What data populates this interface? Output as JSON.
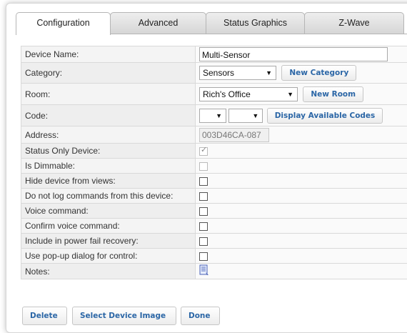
{
  "tabs": [
    {
      "label": "Configuration",
      "active": true
    },
    {
      "label": "Advanced",
      "active": false
    },
    {
      "label": "Status Graphics",
      "active": false
    },
    {
      "label": "Z-Wave",
      "active": false
    }
  ],
  "form": {
    "device_name": {
      "label": "Device Name:",
      "value": "Multi-Sensor"
    },
    "category": {
      "label": "Category:",
      "value": "Sensors",
      "button": "New Category"
    },
    "room": {
      "label": "Room:",
      "value": "Rich's Office",
      "button": "New Room"
    },
    "code": {
      "label": "Code:",
      "value1": "",
      "value2": "",
      "button": "Display Available Codes"
    },
    "address": {
      "label": "Address:",
      "value": "003D46CA-087"
    },
    "checkboxes": [
      {
        "label": "Status Only Device:",
        "checked": true,
        "disabled": true
      },
      {
        "label": "Is Dimmable:",
        "checked": false,
        "disabled": true
      },
      {
        "label": "Hide device from views:",
        "checked": false,
        "disabled": false
      },
      {
        "label": "Do not log commands from this device:",
        "checked": false,
        "disabled": false
      },
      {
        "label": "Voice command:",
        "checked": false,
        "disabled": false
      },
      {
        "label": "Confirm voice command:",
        "checked": false,
        "disabled": false
      },
      {
        "label": "Include in power fail recovery:",
        "checked": false,
        "disabled": false
      },
      {
        "label": "Use pop-up dialog for control:",
        "checked": false,
        "disabled": false
      }
    ],
    "notes": {
      "label": "Notes:",
      "icon": "notes-icon"
    }
  },
  "actions": {
    "delete": "Delete",
    "select_image": "Select Device Image",
    "done": "Done"
  },
  "colors": {
    "button_text": "#2b66a6",
    "tab_border": "#b5b5b5"
  }
}
